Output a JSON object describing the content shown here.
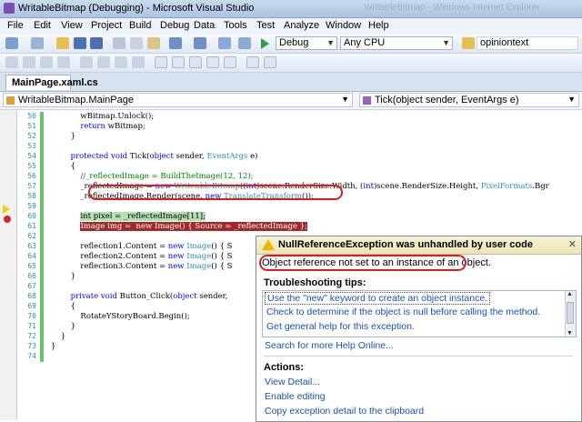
{
  "window": {
    "title": "WritableBitmap (Debugging) - Microsoft Visual Studio",
    "ghost_title": "WritableBitmap - Windows Internet Explorer"
  },
  "menu": [
    "File",
    "Edit",
    "View",
    "Project",
    "Build",
    "Debug",
    "Data",
    "Tools",
    "Test",
    "Analyze",
    "Window",
    "Help"
  ],
  "toolbar": {
    "configuration": "Debug",
    "platform": "Any CPU",
    "find_text": "opiniontext"
  },
  "tab": {
    "label": "MainPage.xaml.cs"
  },
  "nav": {
    "class_combo": "WritableBitmap.MainPage",
    "member_combo": "Tick(object sender, EventArgs e)"
  },
  "editor": {
    "line_numbers": [
      "50",
      "51",
      "52",
      "53",
      "54",
      "55",
      "56",
      "57",
      "58",
      "59",
      "60",
      "61",
      "62",
      "63",
      "64",
      "65",
      "66",
      "67",
      "68",
      "69",
      "70",
      "71",
      "72",
      "73",
      "74"
    ],
    "lines": [
      {
        "n": "50",
        "segs": [
          {
            "t": "            wBitmap.Unlock();",
            "c": ""
          }
        ]
      },
      {
        "n": "51",
        "segs": [
          {
            "t": "            ",
            "c": ""
          },
          {
            "t": "return",
            "c": "kw"
          },
          {
            "t": " wBitmap;",
            "c": ""
          }
        ]
      },
      {
        "n": "52",
        "segs": [
          {
            "t": "        }",
            "c": ""
          }
        ]
      },
      {
        "n": "53",
        "segs": []
      },
      {
        "n": "54",
        "segs": [
          {
            "t": "        ",
            "c": ""
          },
          {
            "t": "protected void",
            "c": "kw"
          },
          {
            "t": " Tick(",
            "c": ""
          },
          {
            "t": "object",
            "c": "kw"
          },
          {
            "t": " sender, ",
            "c": ""
          },
          {
            "t": "EventArgs",
            "c": "ty"
          },
          {
            "t": " e)",
            "c": ""
          }
        ]
      },
      {
        "n": "55",
        "segs": [
          {
            "t": "        {",
            "c": ""
          }
        ]
      },
      {
        "n": "56",
        "segs": [
          {
            "t": "            //_reflectedImage = BuildTheImage(12, 12);",
            "c": "cm"
          }
        ]
      },
      {
        "n": "57",
        "segs": [
          {
            "t": "            _reflectedImage = ",
            "c": ""
          },
          {
            "t": "new",
            "c": "kw"
          },
          {
            "t": " ",
            "c": ""
          },
          {
            "t": "WriteableBitmap",
            "c": "ty"
          },
          {
            "t": "((",
            "c": ""
          },
          {
            "t": "int",
            "c": "kw"
          },
          {
            "t": ")scene.RenderSize.Width, (",
            "c": ""
          },
          {
            "t": "int",
            "c": "kw"
          },
          {
            "t": ")scene.RenderSize.Height, ",
            "c": ""
          },
          {
            "t": "PixelFormats",
            "c": "ty"
          },
          {
            "t": ".Bgr",
            "c": ""
          }
        ]
      },
      {
        "n": "58",
        "segs": [
          {
            "t": "            _reflectedImage.Render(scene, ",
            "c": ""
          },
          {
            "t": "new",
            "c": "kw"
          },
          {
            "t": " ",
            "c": ""
          },
          {
            "t": "TranslateTransform",
            "c": "ty"
          },
          {
            "t": "());",
            "c": ""
          }
        ]
      },
      {
        "n": "59",
        "segs": []
      },
      {
        "n": "60",
        "segs": [
          {
            "t": "            ",
            "c": ""
          },
          {
            "t": "int pixel = _reflectedImage[11];",
            "c": "hl-green"
          }
        ]
      },
      {
        "n": "61",
        "segs": [
          {
            "t": "            ",
            "c": ""
          },
          {
            "t": "Image img =  new Image() { Source = _reflectedImage };",
            "c": "hl-red"
          }
        ]
      },
      {
        "n": "62",
        "segs": []
      },
      {
        "n": "63",
        "segs": [
          {
            "t": "            reflection1.Content = ",
            "c": ""
          },
          {
            "t": "new",
            "c": "kw"
          },
          {
            "t": " ",
            "c": ""
          },
          {
            "t": "Image",
            "c": "ty"
          },
          {
            "t": "() { S",
            "c": ""
          }
        ]
      },
      {
        "n": "64",
        "segs": [
          {
            "t": "            reflection2.Content = ",
            "c": ""
          },
          {
            "t": "new",
            "c": "kw"
          },
          {
            "t": " ",
            "c": ""
          },
          {
            "t": "Image",
            "c": "ty"
          },
          {
            "t": "() { S",
            "c": ""
          }
        ]
      },
      {
        "n": "65",
        "segs": [
          {
            "t": "            reflection3.Content = ",
            "c": ""
          },
          {
            "t": "new",
            "c": "kw"
          },
          {
            "t": " ",
            "c": ""
          },
          {
            "t": "Image",
            "c": "ty"
          },
          {
            "t": "() { S",
            "c": ""
          }
        ]
      },
      {
        "n": "66",
        "segs": [
          {
            "t": "        }",
            "c": ""
          }
        ]
      },
      {
        "n": "67",
        "segs": []
      },
      {
        "n": "68",
        "segs": [
          {
            "t": "        ",
            "c": ""
          },
          {
            "t": "private void",
            "c": "kw"
          },
          {
            "t": " Button_Click(",
            "c": ""
          },
          {
            "t": "object",
            "c": "kw"
          },
          {
            "t": " sender,",
            "c": ""
          }
        ]
      },
      {
        "n": "69",
        "segs": [
          {
            "t": "        {",
            "c": ""
          }
        ]
      },
      {
        "n": "70",
        "segs": [
          {
            "t": "            RotateYStoryBoard.Begin();",
            "c": ""
          }
        ]
      },
      {
        "n": "71",
        "segs": [
          {
            "t": "        }",
            "c": ""
          }
        ]
      },
      {
        "n": "72",
        "segs": [
          {
            "t": "    }",
            "c": ""
          }
        ]
      },
      {
        "n": "73",
        "segs": [
          {
            "t": "}",
            "c": ""
          }
        ]
      },
      {
        "n": "74",
        "segs": []
      }
    ]
  },
  "exception": {
    "title": "NullReferenceException was unhandled by user code",
    "message": "Object reference not set to an instance of an object.",
    "tips_heading": "Troubleshooting tips:",
    "tips": [
      "Use the \"new\" keyword to create an object instance.",
      "Check to determine if the object is null before calling the method.",
      "Get general help for this exception."
    ],
    "search_link": "Search for more Help Online...",
    "actions_heading": "Actions:",
    "actions": [
      "View Detail...",
      "Enable editing",
      "Copy exception detail to the clipboard"
    ],
    "close_glyph": "✕"
  },
  "colors": {
    "error_red": "#d42020",
    "highlight_green": "#b4e0b4",
    "error_line": "#9e2b2b",
    "link": "#1a4fb5"
  }
}
